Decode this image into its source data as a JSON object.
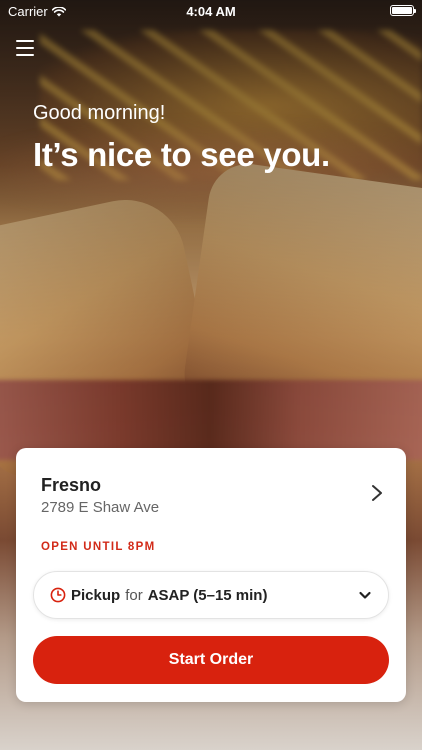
{
  "status_bar": {
    "carrier": "Carrier",
    "time": "4:04 AM"
  },
  "header": {
    "greeting": "Good morning!",
    "headline": "It’s nice to see you."
  },
  "store": {
    "name": "Fresno",
    "address": "2789 E Shaw Ave",
    "hours_status": "OPEN UNTIL 8PM"
  },
  "order": {
    "mode": "Pickup",
    "connector": "for",
    "time": "ASAP (5–15 min)"
  },
  "actions": {
    "start_order": "Start Order"
  },
  "colors": {
    "accent": "#d8220e",
    "status_text": "#d22a18"
  },
  "icons": {
    "menu": "menu-icon",
    "wifi": "wifi-icon",
    "battery": "battery-icon",
    "chevron_right": "chevron-right-icon",
    "clock": "clock-icon",
    "chevron_down": "chevron-down-icon"
  }
}
